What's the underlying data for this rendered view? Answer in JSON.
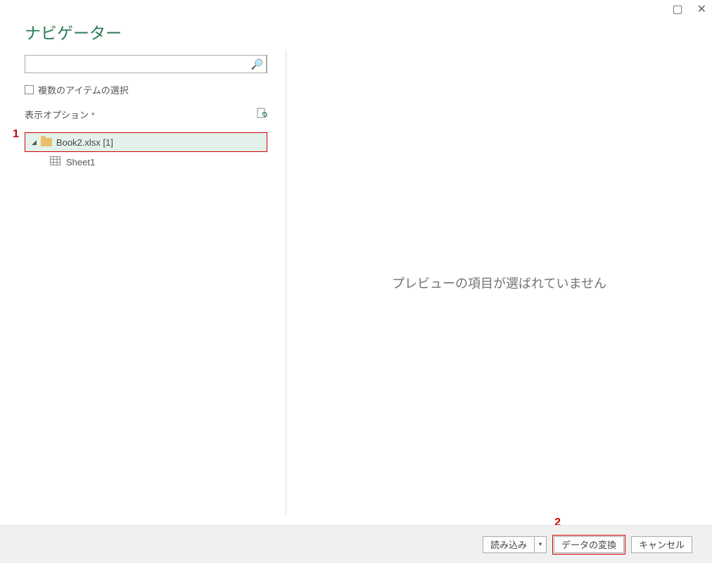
{
  "title": "ナビゲーター",
  "search": {
    "placeholder": ""
  },
  "multi_select_label": "複数のアイテムの選択",
  "display_options_label": "表示オプション",
  "tree": {
    "root": {
      "label": "Book2.xlsx [1]"
    },
    "children": [
      {
        "label": "Sheet1"
      }
    ]
  },
  "preview_message": "プレビューの項目が選ばれていません",
  "footer": {
    "load": "読み込み",
    "transform": "データの変換",
    "cancel": "キャンセル"
  },
  "callouts": {
    "one": "1",
    "two": "2"
  }
}
